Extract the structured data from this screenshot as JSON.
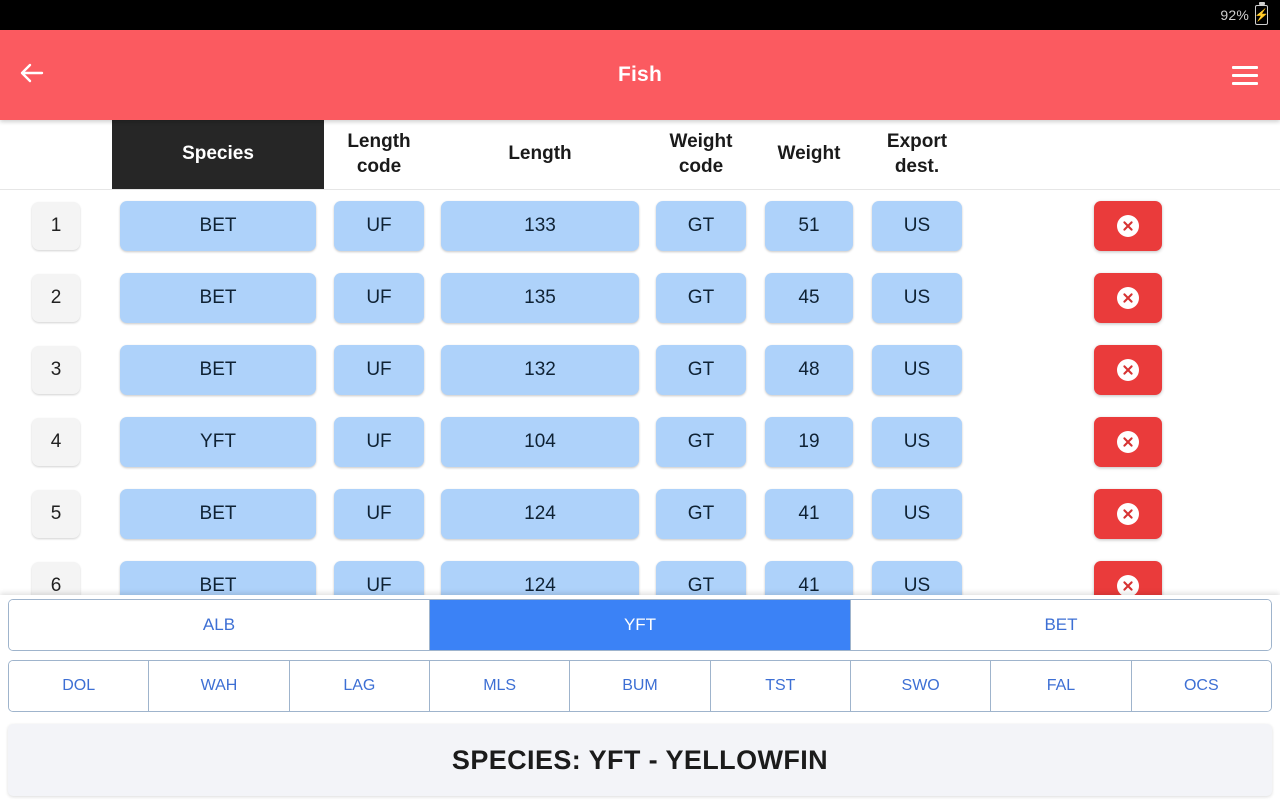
{
  "status_bar": {
    "battery_percent": "92%",
    "battery_icon": "battery-charging-icon"
  },
  "app_bar": {
    "title": "Fish",
    "back_icon": "arrow-left-icon",
    "menu_icon": "hamburger-menu-icon",
    "background_color": "#fb5a60"
  },
  "table": {
    "columns": [
      {
        "key": "num",
        "label": "",
        "selected": false
      },
      {
        "key": "species",
        "label": "Species",
        "selected": true
      },
      {
        "key": "length_code",
        "label": "Length\ncode",
        "line1": "Length",
        "line2": "code",
        "selected": false
      },
      {
        "key": "length",
        "label": "Length",
        "line1": "Length",
        "line2": "",
        "selected": false
      },
      {
        "key": "weight_code",
        "label": "Weight\ncode",
        "line1": "Weight",
        "line2": "code",
        "selected": false
      },
      {
        "key": "weight",
        "label": "Weight",
        "line1": "Weight",
        "line2": "",
        "selected": false
      },
      {
        "key": "export_dest",
        "label": "Export\ndest.",
        "line1": "Export",
        "line2": "dest.",
        "selected": false
      }
    ],
    "delete_icon": "delete-circle-x-icon",
    "rows": [
      {
        "num": "1",
        "species": "BET",
        "length_code": "UF",
        "length": "133",
        "weight_code": "GT",
        "weight": "51",
        "export_dest": "US"
      },
      {
        "num": "2",
        "species": "BET",
        "length_code": "UF",
        "length": "135",
        "weight_code": "GT",
        "weight": "45",
        "export_dest": "US"
      },
      {
        "num": "3",
        "species": "BET",
        "length_code": "UF",
        "length": "132",
        "weight_code": "GT",
        "weight": "48",
        "export_dest": "US"
      },
      {
        "num": "4",
        "species": "YFT",
        "length_code": "UF",
        "length": "104",
        "weight_code": "GT",
        "weight": "19",
        "export_dest": "US"
      },
      {
        "num": "5",
        "species": "BET",
        "length_code": "UF",
        "length": "124",
        "weight_code": "GT",
        "weight": "41",
        "export_dest": "US"
      },
      {
        "num": "6",
        "species": "BET",
        "length_code": "UF",
        "length": "124",
        "weight_code": "GT",
        "weight": "41",
        "export_dest": "US"
      }
    ]
  },
  "species_picker": {
    "primary": [
      {
        "code": "ALB",
        "active": false
      },
      {
        "code": "YFT",
        "active": true
      },
      {
        "code": "BET",
        "active": false
      }
    ],
    "secondary": [
      {
        "code": "DOL",
        "active": false
      },
      {
        "code": "WAH",
        "active": false
      },
      {
        "code": "LAG",
        "active": false
      },
      {
        "code": "MLS",
        "active": false
      },
      {
        "code": "BUM",
        "active": false
      },
      {
        "code": "TST",
        "active": false
      },
      {
        "code": "SWO",
        "active": false
      },
      {
        "code": "FAL",
        "active": false
      },
      {
        "code": "OCS",
        "active": false
      }
    ],
    "active_color": "#3b82f6",
    "banner": "SPECIES: YFT - YELLOWFIN"
  }
}
